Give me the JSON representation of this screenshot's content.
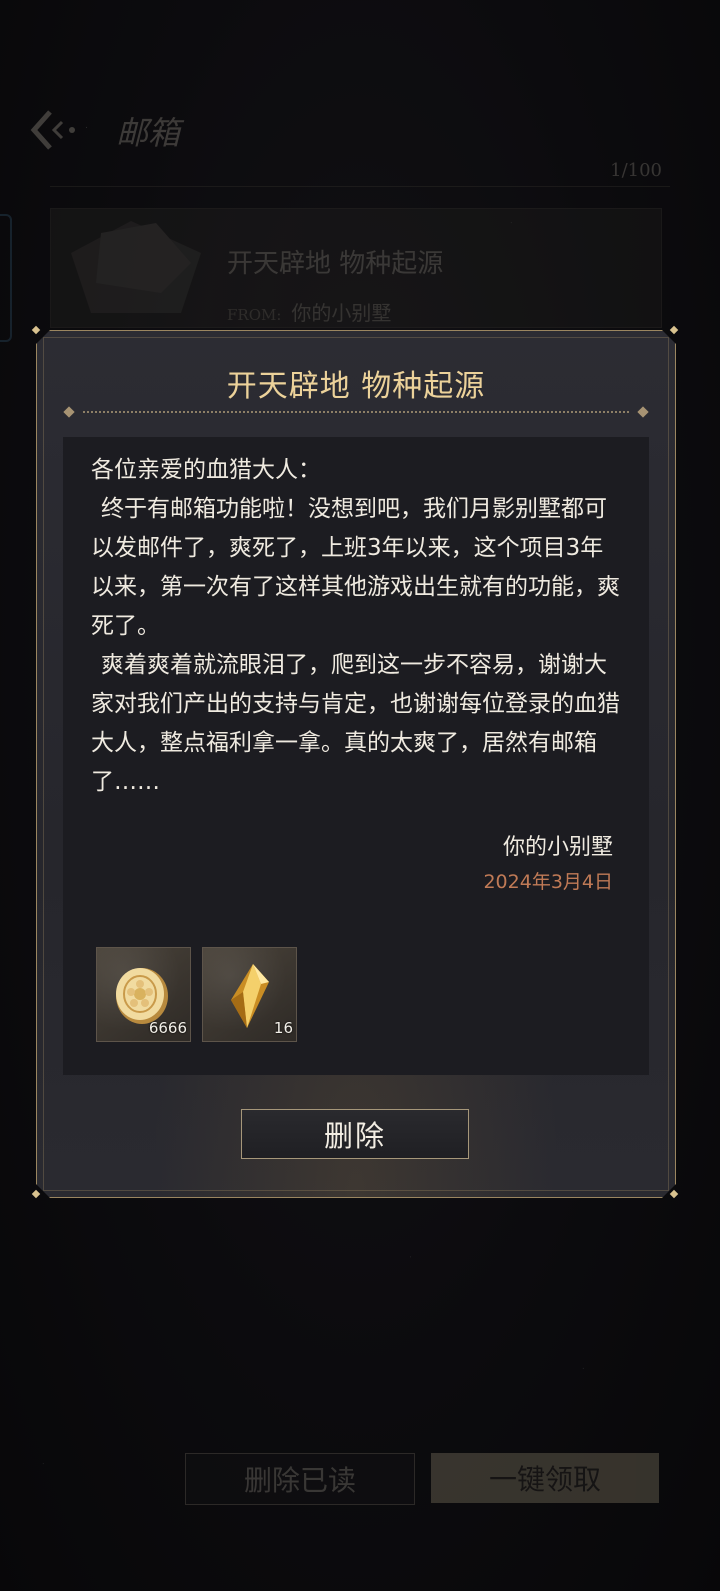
{
  "header": {
    "title": "邮箱",
    "count": "1/100"
  },
  "mail_list": [
    {
      "title": "开天辟地 物种起源",
      "from_label": "FROM:",
      "from": "你的小别墅"
    }
  ],
  "bottom_buttons": {
    "delete_read": "删除已读",
    "claim_all": "一键领取"
  },
  "dialog": {
    "title": "开天辟地 物种起源",
    "greeting": "各位亲爱的血猎大人：",
    "paragraph1": "终于有邮箱功能啦！没想到吧，我们月影别墅都可以发邮件了，爽死了，上班3年以来，这个项目3年以来，第一次有了这样其他游戏出生就有的功能，爽死了。",
    "paragraph2": "爽着爽着就流眼泪了，爬到这一步不容易，谢谢大家对我们产出的支持与肯定，也谢谢每位登录的血猎大人，整点福利拿一拿。真的太爽了，居然有邮箱了……",
    "signature": "你的小别墅",
    "date": "2024年3月4日",
    "rewards": [
      {
        "icon": "gold-coin-icon",
        "quantity": "6666"
      },
      {
        "icon": "gold-crystal-icon",
        "quantity": "16"
      }
    ],
    "delete_label": "删除"
  }
}
